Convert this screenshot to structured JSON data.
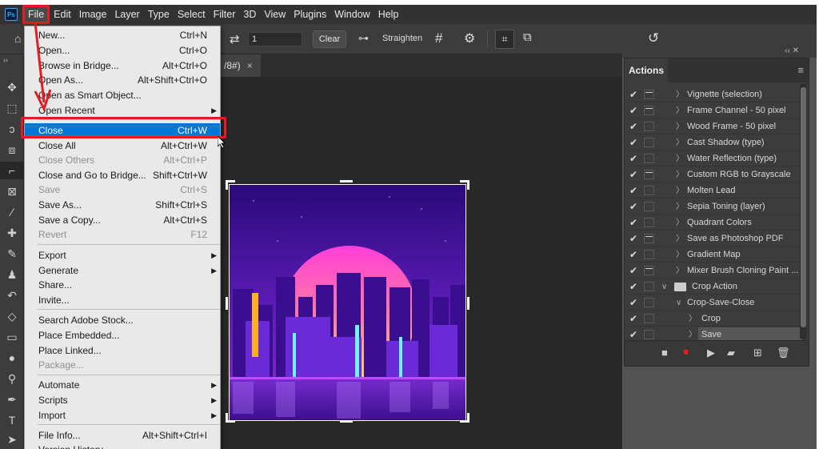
{
  "menubar": {
    "logo": "Ps",
    "items": [
      "File",
      "Edit",
      "Image",
      "Layer",
      "Type",
      "Select",
      "Filter",
      "3D",
      "View",
      "Plugins",
      "Window",
      "Help"
    ]
  },
  "options": {
    "ratio_value": "1",
    "clear_label": "Clear",
    "straighten_label": "Straighten"
  },
  "document": {
    "tab_suffix": "/8#)",
    "close": "×"
  },
  "file_menu": {
    "items": [
      {
        "label": "New...",
        "shortcut": "Ctrl+N"
      },
      {
        "label": "Open...",
        "shortcut": "Ctrl+O"
      },
      {
        "label": "Browse in Bridge...",
        "shortcut": "Alt+Ctrl+O"
      },
      {
        "label": "Open As...",
        "shortcut": "Alt+Shift+Ctrl+O"
      },
      {
        "label": "Open as Smart Object...",
        "shortcut": ""
      },
      {
        "label": "Open Recent",
        "shortcut": ""
      },
      {
        "label": "Close",
        "shortcut": "Ctrl+W"
      },
      {
        "label": "Close All",
        "shortcut": "Alt+Ctrl+W"
      },
      {
        "label": "Close Others",
        "shortcut": "Alt+Ctrl+P"
      },
      {
        "label": "Close and Go to Bridge...",
        "shortcut": "Shift+Ctrl+W"
      },
      {
        "label": "Save",
        "shortcut": "Ctrl+S"
      },
      {
        "label": "Save As...",
        "shortcut": "Shift+Ctrl+S"
      },
      {
        "label": "Save a Copy...",
        "shortcut": "Alt+Ctrl+S"
      },
      {
        "label": "Revert",
        "shortcut": "F12"
      },
      {
        "label": "Export",
        "shortcut": ""
      },
      {
        "label": "Generate",
        "shortcut": ""
      },
      {
        "label": "Share...",
        "shortcut": ""
      },
      {
        "label": "Invite...",
        "shortcut": ""
      },
      {
        "label": "Search Adobe Stock...",
        "shortcut": ""
      },
      {
        "label": "Place Embedded...",
        "shortcut": ""
      },
      {
        "label": "Place Linked...",
        "shortcut": ""
      },
      {
        "label": "Package...",
        "shortcut": ""
      },
      {
        "label": "Automate",
        "shortcut": ""
      },
      {
        "label": "Scripts",
        "shortcut": ""
      },
      {
        "label": "Import",
        "shortcut": ""
      },
      {
        "label": "File Info...",
        "shortcut": "Alt+Shift+Ctrl+I"
      },
      {
        "label": "Version History",
        "shortcut": ""
      }
    ]
  },
  "actions_panel": {
    "title": "Actions",
    "rows": [
      {
        "label": "Vignette (selection)"
      },
      {
        "label": "Frame Channel - 50 pixel"
      },
      {
        "label": "Wood Frame - 50 pixel"
      },
      {
        "label": "Cast Shadow (type)"
      },
      {
        "label": "Water Reflection (type)"
      },
      {
        "label": "Custom RGB to Grayscale"
      },
      {
        "label": "Molten Lead"
      },
      {
        "label": "Sepia Toning (layer)"
      },
      {
        "label": "Quadrant Colors"
      },
      {
        "label": "Save as Photoshop PDF"
      },
      {
        "label": "Gradient Map"
      },
      {
        "label": "Mixer Brush Cloning Paint ..."
      },
      {
        "label": "Crop Action"
      },
      {
        "label": "Crop-Save-Close"
      },
      {
        "label": "Crop"
      },
      {
        "label": "Save"
      }
    ]
  },
  "colors": {
    "highlight_red": "#e31b23",
    "menu_selection": "#0078d7",
    "record_red": "#e31b23"
  }
}
